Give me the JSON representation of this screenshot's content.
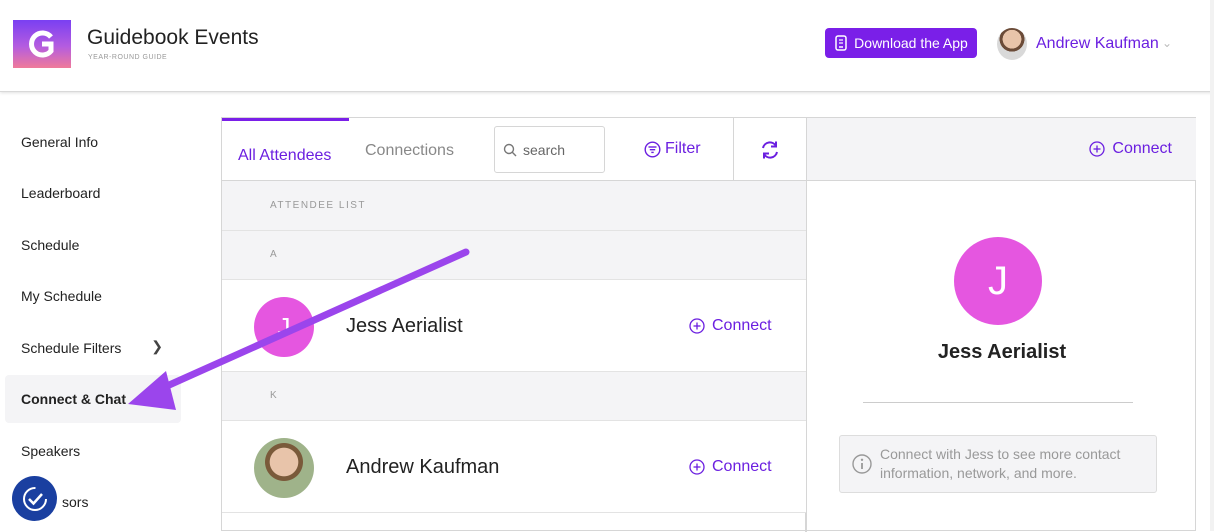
{
  "header": {
    "title": "Guidebook Events",
    "subtitle": "YEAR-ROUND GUIDE",
    "download_label": "Download the App",
    "user_name": "Andrew Kaufman"
  },
  "sidebar": {
    "items": [
      {
        "label": "General Info"
      },
      {
        "label": "Leaderboard"
      },
      {
        "label": "Schedule"
      },
      {
        "label": "My Schedule"
      },
      {
        "label": "Schedule Filters"
      },
      {
        "label": "Connect & Chat"
      },
      {
        "label": "Speakers"
      },
      {
        "label": "sors"
      }
    ]
  },
  "tabs": {
    "all_attendees": "All Attendees",
    "connections": "Connections",
    "search_placeholder": "search",
    "filter": "Filter"
  },
  "list": {
    "header": "ATTENDEE LIST",
    "sections": [
      {
        "letter": "A",
        "name": "Jess Aerialist",
        "initial": "J",
        "connect": "Connect"
      },
      {
        "letter": "K",
        "name": "Andrew Kaufman",
        "connect": "Connect"
      }
    ]
  },
  "detail": {
    "connect": "Connect",
    "initial": "J",
    "name": "Jess Aerialist",
    "info": "Connect with Jess to see more contact information, network, and more."
  },
  "colors": {
    "accent": "#7a1fe8",
    "avatar_pink": "#e556e0",
    "annotation_arrow": "#9b45ec"
  }
}
